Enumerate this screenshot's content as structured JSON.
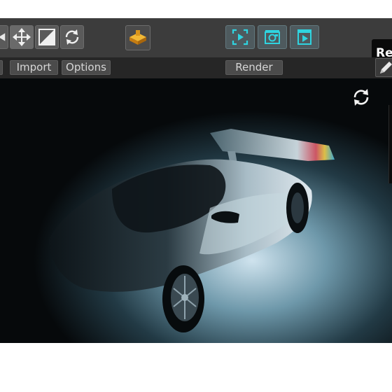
{
  "toolbar": {
    "right_label": "Re"
  },
  "subbar": {
    "import_label": "Import",
    "options_label": "Options",
    "render_label": "Render"
  },
  "colors": {
    "toolbar_bg": "#3c3c3c",
    "subbar_bg": "#262626",
    "accent_cyan": "#2fd4e0",
    "accent_gold": "#e6a21f"
  },
  "icons": [
    "arrow-left-icon",
    "move-icon",
    "scale-icon",
    "rotate-icon",
    "object-cube-icon",
    "render-frame-icon",
    "camera-render-icon",
    "play-render-icon",
    "pencil-icon",
    "refresh-icon"
  ]
}
